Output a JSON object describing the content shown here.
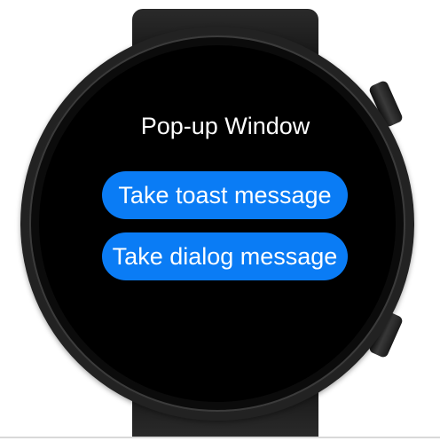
{
  "screen": {
    "title": "Pop-up Window",
    "buttons": {
      "toast_label": "Take toast message",
      "dialog_label": "Take dialog message"
    }
  },
  "colors": {
    "accent": "#0a7cf5",
    "screen_background": "#000000",
    "text": "#ffffff"
  }
}
